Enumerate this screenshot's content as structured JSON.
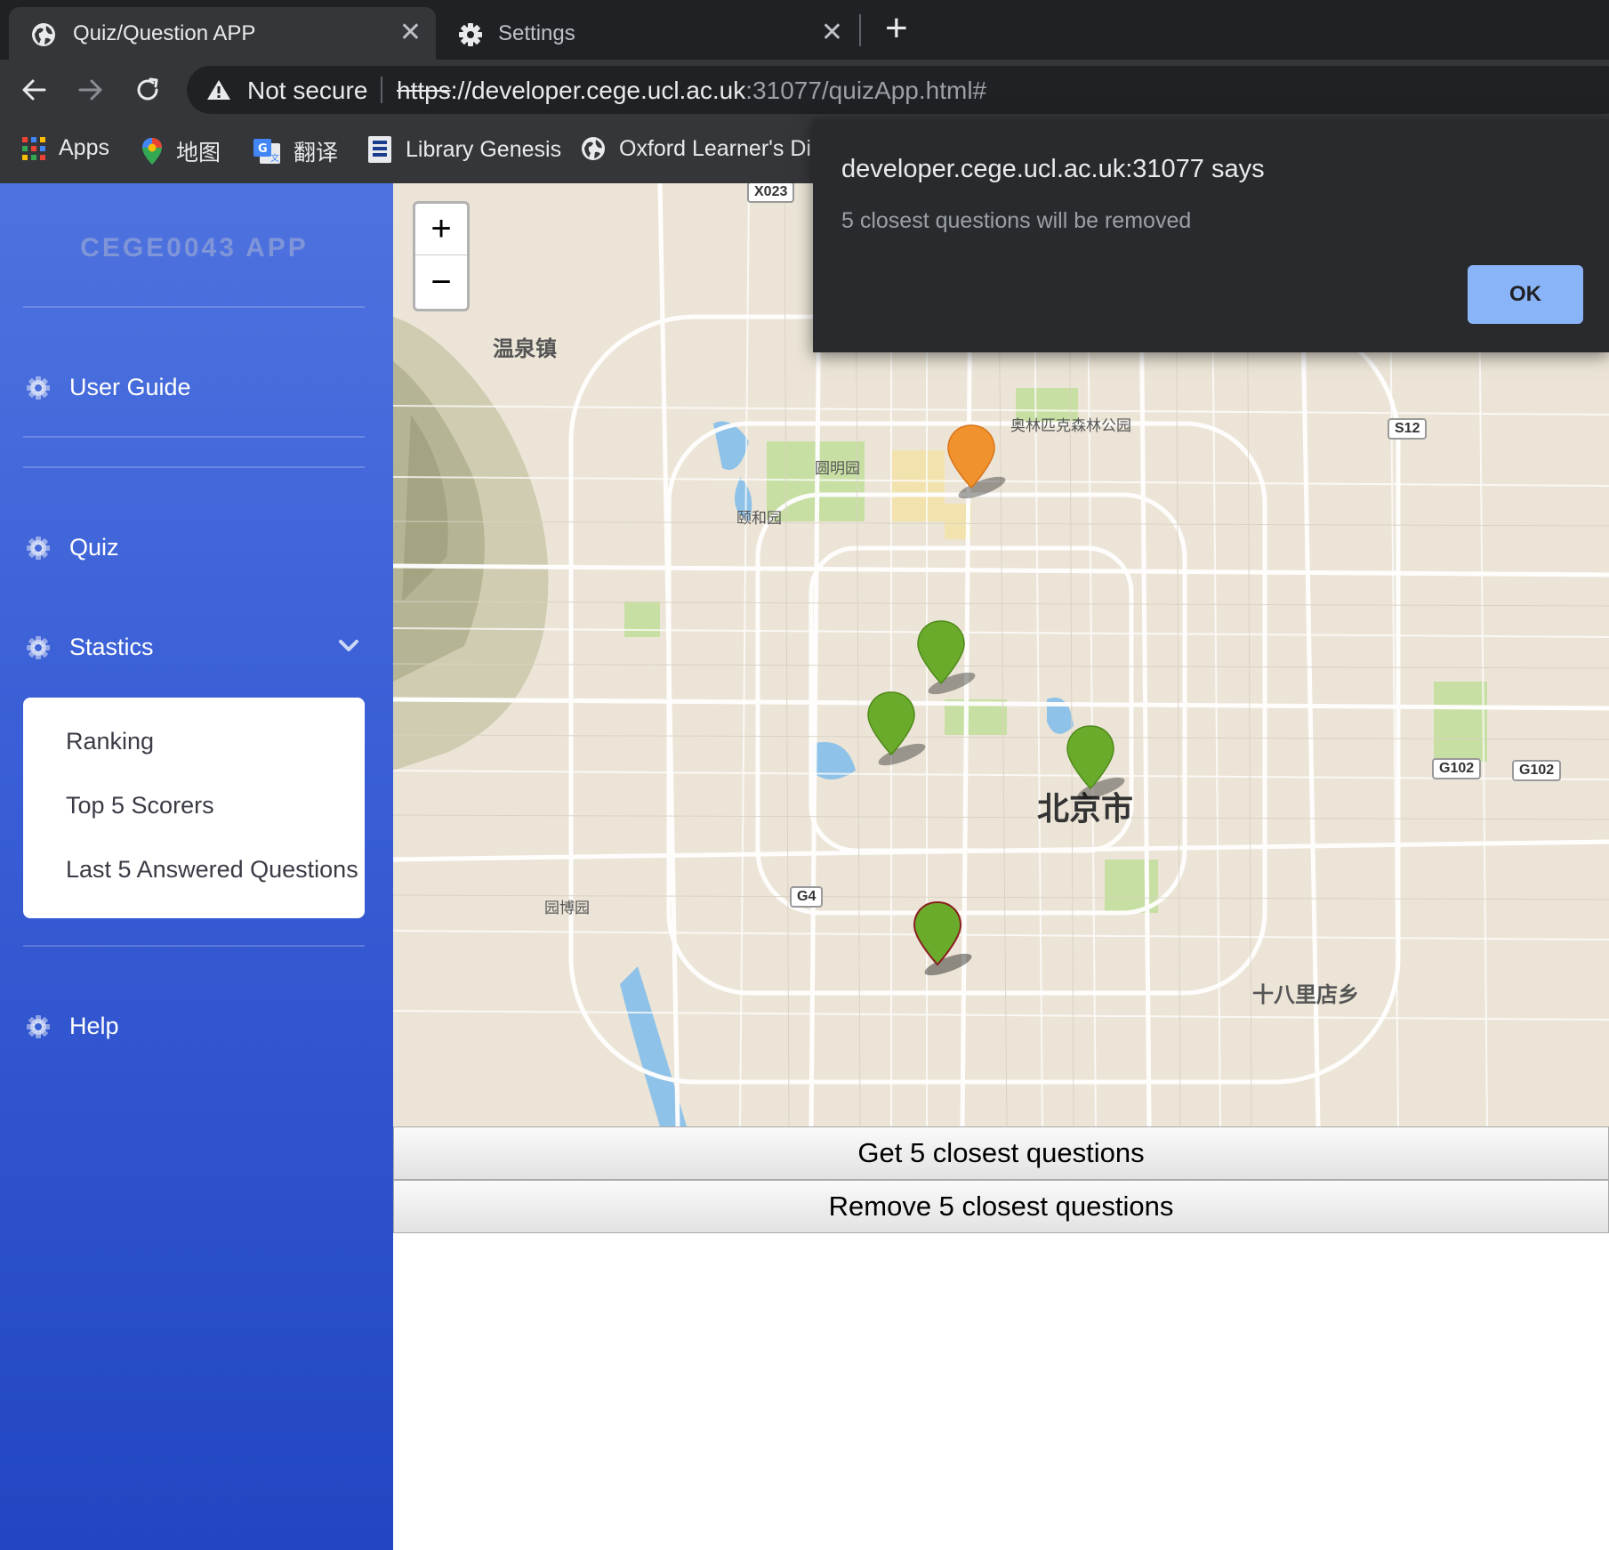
{
  "browser": {
    "tabs": [
      {
        "title": "Quiz/Question APP",
        "icon": "globe-icon",
        "active": true
      },
      {
        "title": "Settings",
        "icon": "gear-icon",
        "active": false
      }
    ],
    "close_glyph": "✕",
    "new_tab_glyph": "+",
    "security_label": "Not secure",
    "url": {
      "scheme": "https",
      "sep": "://",
      "host": "developer.cege.ucl.ac.uk",
      "path": ":31077/quizApp.html#"
    },
    "bookmarks": [
      {
        "label": "Apps",
        "icon": "apps-grid-icon"
      },
      {
        "label": "地图",
        "icon": "maps-pin-icon"
      },
      {
        "label": "翻译",
        "icon": "translate-icon"
      },
      {
        "label": "Library Genesis",
        "icon": "book-icon"
      },
      {
        "label": "Oxford Learner's Di...",
        "icon": "globe-icon"
      }
    ]
  },
  "sidebar": {
    "brand": "CEGE0043 APP",
    "items": [
      {
        "label": "User Guide",
        "icon": "gear-icon"
      },
      {
        "label": "Quiz",
        "icon": "gear-icon"
      },
      {
        "label": "Stastics",
        "icon": "gear-icon",
        "expanded": true
      },
      {
        "label": "Help",
        "icon": "gear-icon"
      }
    ],
    "submenu": [
      "Ranking",
      "Top 5 Scorers",
      "Last 5 Answered Questions"
    ]
  },
  "map": {
    "zoom_in": "+",
    "zoom_out": "−",
    "labels": {
      "wenquan": "温泉镇",
      "olympic": "奥林匹克森林公园",
      "yuanmingyuan": "圆明园",
      "yiheyuan": "颐和园",
      "beijing": "北京市",
      "yuanboyuan": "园博园",
      "shibalidian": "十八里店乡"
    },
    "shields": {
      "x023": "X023",
      "s12": "S12",
      "g102a": "G102",
      "g102b": "G102",
      "g4": "G4"
    },
    "markers": [
      {
        "color": "#f0922d",
        "kind": "user-location"
      },
      {
        "color": "#6aab2b",
        "kind": "question"
      },
      {
        "color": "#6aab2b",
        "kind": "question"
      },
      {
        "color": "#6aab2b",
        "kind": "question"
      },
      {
        "color": "#6aab2b",
        "kind": "question"
      }
    ]
  },
  "actions": {
    "get_closest": "Get 5 closest questions",
    "remove_closest": "Remove 5 closest questions"
  },
  "dialog": {
    "title": "developer.cege.ucl.ac.uk:31077 says",
    "message": "5 closest questions will be removed",
    "ok": "OK"
  },
  "colors": {
    "sidebar_top": "#4e73df",
    "sidebar_bottom": "#2246c3",
    "marker_orange": "#f0922d",
    "marker_green": "#6aab2b",
    "dialog_button": "#8ab4f8"
  }
}
